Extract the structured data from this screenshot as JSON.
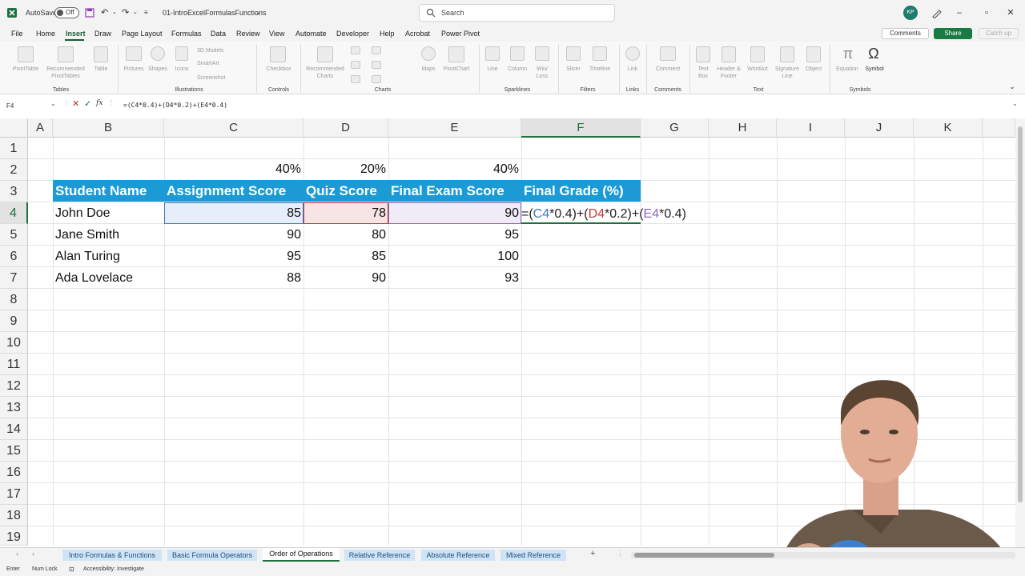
{
  "titlebar": {
    "autosave_label": "AutoSave",
    "autosave_state": "Off",
    "filename": "01-IntroExcelFormulasFunctions",
    "search_placeholder": "Search",
    "user_initials": "KP"
  },
  "menu": {
    "tabs": [
      "File",
      "Home",
      "Insert",
      "Draw",
      "Page Layout",
      "Formulas",
      "Data",
      "Review",
      "View",
      "Automate",
      "Developer",
      "Help",
      "Acrobat",
      "Power Pivot"
    ],
    "active": "Insert",
    "comments_label": "Comments",
    "share_label": "Share",
    "catchup_label": "Catch up"
  },
  "ribbon": {
    "tables": {
      "label": "Tables",
      "items": [
        "PivotTable",
        "Recommended PivotTables",
        "Table"
      ]
    },
    "illustrations": {
      "label": "Illustrations",
      "items": [
        "Pictures",
        "Shapes",
        "Icons",
        "3D Models",
        "SmartArt",
        "Screenshot"
      ]
    },
    "controls": {
      "label": "Controls",
      "items": [
        "Checkbox"
      ]
    },
    "charts": {
      "label": "Charts",
      "items": [
        "Recommended Charts",
        "Maps",
        "PivotChart"
      ]
    },
    "sparklines": {
      "label": "Sparklines",
      "items": [
        "Line",
        "Column",
        "Win/ Loss"
      ]
    },
    "filters": {
      "label": "Filters",
      "items": [
        "Slicer",
        "Timeline"
      ]
    },
    "links": {
      "label": "Links",
      "items": [
        "Link"
      ]
    },
    "comments": {
      "label": "Comments",
      "items": [
        "Comment"
      ]
    },
    "text": {
      "label": "Text",
      "items": [
        "Text Box",
        "Header & Footer",
        "WordArt",
        "Signature Line",
        "Object"
      ]
    },
    "symbols": {
      "label": "Symbols",
      "items": [
        "Equation",
        "Symbol"
      ]
    }
  },
  "formula_bar": {
    "name_box": "F4",
    "formula": "=(C4*0.4)+(D4*0.2)+(E4*0.4)"
  },
  "columns": [
    "A",
    "B",
    "C",
    "D",
    "E",
    "F",
    "G",
    "H",
    "I",
    "J",
    "K"
  ],
  "rows": [
    "1",
    "2",
    "3",
    "4",
    "5",
    "6",
    "7",
    "8",
    "9",
    "10",
    "11",
    "12",
    "13",
    "14",
    "15",
    "16",
    "17",
    "18",
    "19"
  ],
  "sheet": {
    "weights": [
      "40%",
      "20%",
      "40%"
    ],
    "headers": [
      "Student Name",
      "Assignment Score",
      "Quiz Score",
      "Final Exam Score",
      "Final Grade (%)"
    ],
    "students": [
      {
        "name": "John Doe",
        "assignment": "85",
        "quiz": "78",
        "exam": "90"
      },
      {
        "name": "Jane Smith",
        "assignment": "90",
        "quiz": "80",
        "exam": "95"
      },
      {
        "name": "Alan Turing",
        "assignment": "95",
        "quiz": "85",
        "exam": "100"
      },
      {
        "name": "Ada Lovelace",
        "assignment": "88",
        "quiz": "90",
        "exam": "93"
      }
    ],
    "edit_formula": {
      "p1": "=(",
      "r1": "C4",
      "p2": "*0.4)+(",
      "r2": "D4",
      "p3": "*0.2)+(",
      "r3": "E4",
      "p4": "*0.4)"
    }
  },
  "sheet_tabs": [
    "Intro Formulas & Functions",
    "Basic Formula Operators",
    "Order of Operations",
    "Relative Reference",
    "Absolute Reference",
    "Mixed Reference"
  ],
  "active_sheet": "Order of Operations",
  "status": {
    "mode": "Enter",
    "num_lock": "Num Lock",
    "accessibility": "Accessibility: Investigate"
  },
  "colors": {
    "excel_green": "#1d6f3e",
    "header_fill": "#1c9ad6",
    "ref_c": "#3b78c8",
    "ref_d": "#c0393b",
    "ref_e": "#8d68c2"
  }
}
